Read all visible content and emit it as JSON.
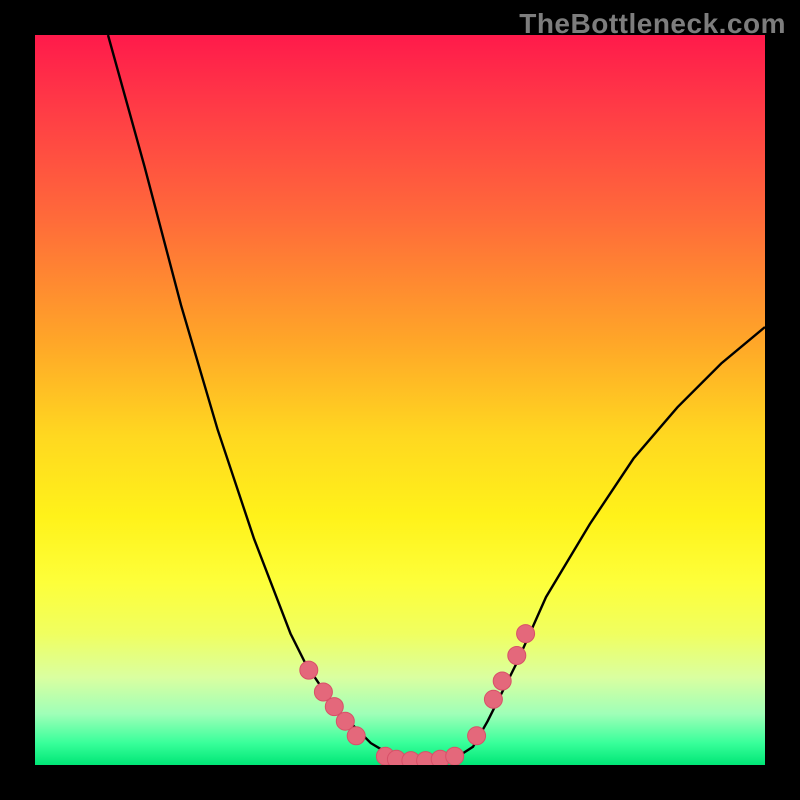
{
  "watermark": "TheBottleneck.com",
  "colors": {
    "background": "#000000",
    "curve": "#000000",
    "marker_fill": "#e4687b",
    "marker_stroke": "#d85068",
    "gradient_top": "#ff1a4b",
    "gradient_bottom": "#00e676"
  },
  "chart_data": {
    "type": "line",
    "title": "",
    "xlabel": "",
    "ylabel": "",
    "xlim": [
      0,
      100
    ],
    "ylim": [
      0,
      100
    ],
    "grid": false,
    "legend": false,
    "series": [
      {
        "name": "curve",
        "x": [
          10,
          15,
          20,
          25,
          30,
          35,
          37,
          39,
          41,
          43,
          46,
          49,
          52,
          55,
          58,
          60,
          62,
          66,
          70,
          76,
          82,
          88,
          94,
          100
        ],
        "y": [
          100,
          82,
          63,
          46,
          31,
          18,
          14,
          11,
          8,
          6,
          3,
          1.2,
          0.4,
          0.4,
          1.2,
          2.5,
          6,
          14,
          23,
          33,
          42,
          49,
          55,
          60
        ]
      }
    ],
    "markers": [
      {
        "x": 37.5,
        "y": 13
      },
      {
        "x": 39.5,
        "y": 10
      },
      {
        "x": 41.0,
        "y": 8
      },
      {
        "x": 42.5,
        "y": 6
      },
      {
        "x": 44.0,
        "y": 4
      },
      {
        "x": 48.0,
        "y": 1.2
      },
      {
        "x": 49.5,
        "y": 0.8
      },
      {
        "x": 51.5,
        "y": 0.6
      },
      {
        "x": 53.5,
        "y": 0.6
      },
      {
        "x": 55.5,
        "y": 0.8
      },
      {
        "x": 57.5,
        "y": 1.2
      },
      {
        "x": 60.5,
        "y": 4
      },
      {
        "x": 62.8,
        "y": 9
      },
      {
        "x": 64.0,
        "y": 11.5
      },
      {
        "x": 66.0,
        "y": 15
      },
      {
        "x": 67.2,
        "y": 18
      }
    ]
  }
}
